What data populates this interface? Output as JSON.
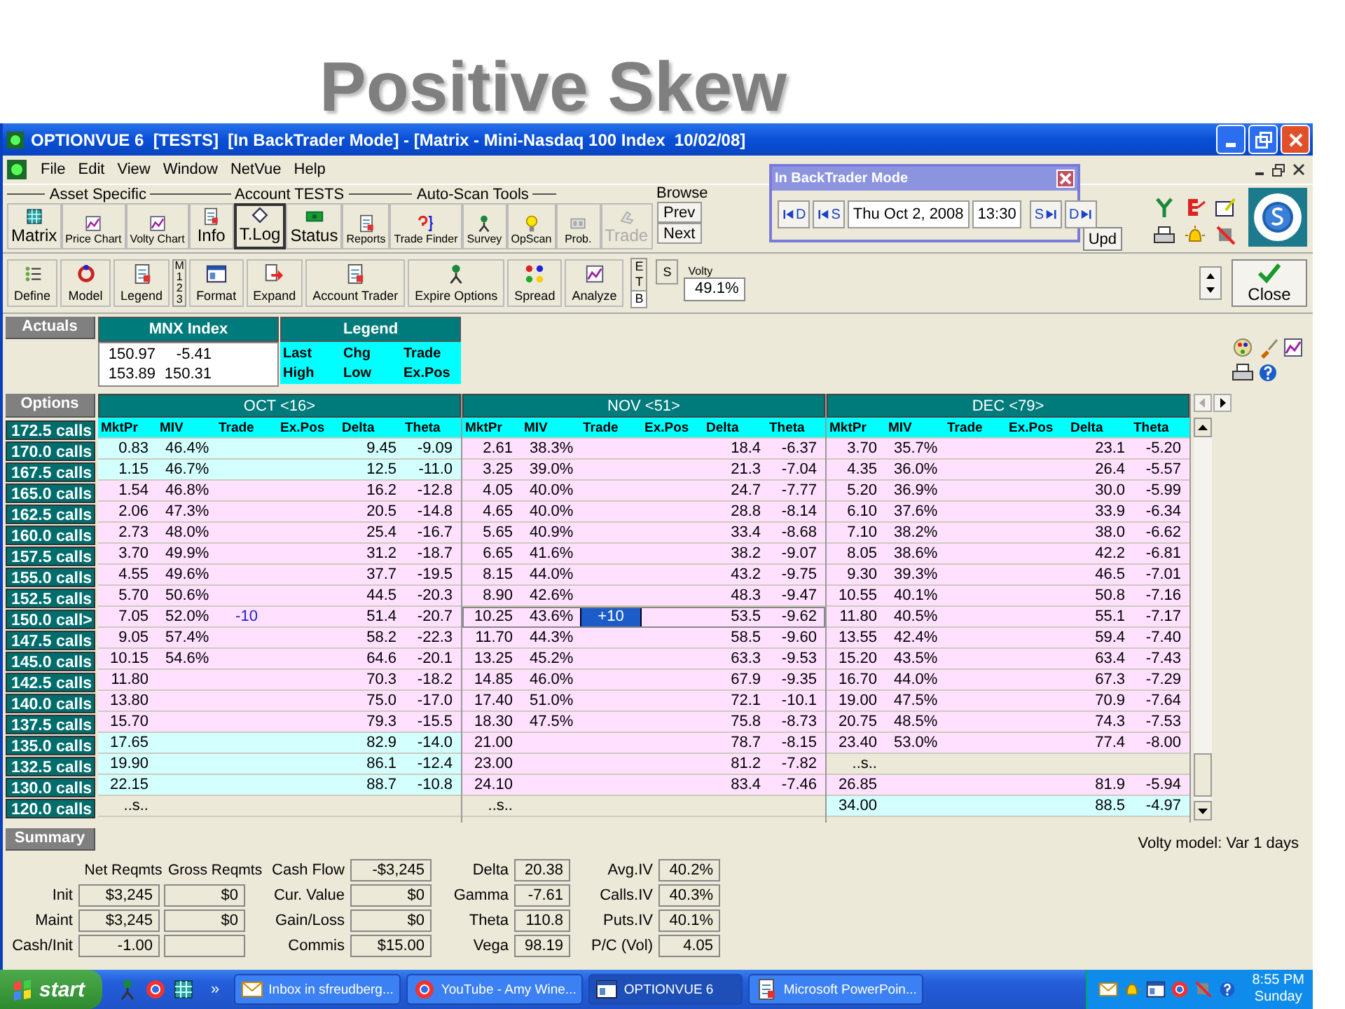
{
  "slide_title": "Positive Skew",
  "window": {
    "title": "OPTIONVUE 6  [TESTS]  [In BackTrader Mode] - [Matrix - Mini-Nasdaq 100 Index  10/02/08]"
  },
  "menu": [
    "File",
    "Edit",
    "View",
    "Window",
    "NetVue",
    "Help"
  ],
  "toolbar": {
    "groups": [
      {
        "label": "Asset Specific",
        "buttons": [
          {
            "label": "Matrix",
            "kind": "large",
            "pressed": false,
            "disabled": false
          },
          {
            "label": "Price Chart",
            "kind": "small",
            "pressed": false,
            "disabled": false
          },
          {
            "label": "Volty Chart",
            "kind": "small",
            "pressed": false,
            "disabled": false
          }
        ]
      },
      {
        "label": "Account TESTS",
        "buttons": [
          {
            "label": "Info",
            "kind": "large",
            "pressed": false,
            "disabled": false
          },
          {
            "label": "T.Log",
            "kind": "large",
            "pressed": true,
            "disabled": false
          },
          {
            "label": "Status",
            "kind": "large",
            "pressed": false,
            "disabled": false
          },
          {
            "label": "Reports",
            "kind": "small",
            "pressed": false,
            "disabled": false
          }
        ]
      },
      {
        "label": "Auto-Scan Tools",
        "buttons": [
          {
            "label": "Trade Finder",
            "kind": "small",
            "pressed": false,
            "disabled": false
          },
          {
            "label": "Survey",
            "kind": "small",
            "pressed": false,
            "disabled": false
          },
          {
            "label": "OpScan",
            "kind": "small",
            "pressed": false,
            "disabled": false
          }
        ]
      }
    ],
    "extra_buttons": [
      {
        "label": "Prob.",
        "kind": "small",
        "pressed": false,
        "disabled": false
      },
      {
        "label": "Trade",
        "kind": "large",
        "pressed": false,
        "disabled": true
      }
    ],
    "browse": {
      "label": "Browse",
      "buttons": [
        "Prev",
        "Next"
      ]
    },
    "update_button": "Upd"
  },
  "toolbar2": {
    "buttons": [
      "Define",
      "Model",
      "Legend",
      "Format",
      "Expand",
      "Account Trader",
      "Expire Options",
      "Spread",
      "Analyze"
    ],
    "matrix_tabs": [
      "M",
      "1",
      "2",
      "3"
    ],
    "view_tabs": [
      {
        "label": "E",
        "selected": false
      },
      {
        "label": "T",
        "selected": false
      },
      {
        "label": "B",
        "selected": true
      }
    ],
    "s_box": "S",
    "volty": {
      "label": "Volty",
      "value": "49.1%"
    },
    "close_button": "Close"
  },
  "backtrader_dialog": {
    "title": "In BackTrader Mode",
    "back_buttons": [
      "D",
      "S"
    ],
    "date": "Thu Oct 2, 2008",
    "time": "13:30",
    "forward_buttons": [
      "S",
      "D"
    ]
  },
  "actuals": {
    "label": "Actuals",
    "index": {
      "title": "MNX Index",
      "rows": [
        [
          "150.97",
          "-5.41"
        ],
        [
          "153.89",
          "150.31"
        ]
      ]
    },
    "legend": {
      "title": "Legend",
      "rows": [
        [
          "Last",
          "Chg",
          "Trade"
        ],
        [
          "High",
          "Low",
          "Ex.Pos"
        ]
      ]
    }
  },
  "options": {
    "label": "Options",
    "strikes": [
      "172.5 calls",
      "170.0 calls",
      "167.5 calls",
      "165.0 calls",
      "162.5 calls",
      "160.0 calls",
      "157.5 calls",
      "155.0 calls",
      "152.5 calls",
      "150.0 call>",
      "147.5 calls",
      "145.0 calls",
      "142.5 calls",
      "140.0 calls",
      "137.5 calls",
      "135.0 calls",
      "132.5 calls",
      "130.0 calls",
      "120.0 calls"
    ],
    "months": [
      {
        "label": "OCT <16>",
        "columns": [
          "MktPr",
          "MIV",
          "Trade",
          "Ex.Pos",
          "Delta",
          "Theta"
        ],
        "rows": [
          {
            "color": "#d4ffff",
            "selected": false,
            "mktpr": "0.83",
            "miv": "46.4%",
            "delta": "9.45",
            "theta": "-9.09"
          },
          {
            "color": "#d4ffff",
            "selected": false,
            "mktpr": "1.15",
            "miv": "46.7%",
            "delta": "12.5",
            "theta": "-11.0"
          },
          {
            "color": "#ffe0ff",
            "selected": false,
            "mktpr": "1.54",
            "miv": "46.8%",
            "delta": "16.2",
            "theta": "-12.8"
          },
          {
            "color": "#ffe0ff",
            "selected": false,
            "mktpr": "2.06",
            "miv": "47.3%",
            "delta": "20.5",
            "theta": "-14.8"
          },
          {
            "color": "#ffe0ff",
            "selected": false,
            "mktpr": "2.73",
            "miv": "48.0%",
            "delta": "25.4",
            "theta": "-16.7"
          },
          {
            "color": "#ffe0ff",
            "selected": false,
            "mktpr": "3.70",
            "miv": "49.9%",
            "delta": "31.2",
            "theta": "-18.7"
          },
          {
            "color": "#ffe0ff",
            "selected": false,
            "mktpr": "4.55",
            "miv": "49.6%",
            "delta": "37.7",
            "theta": "-19.5"
          },
          {
            "color": "#ffe0ff",
            "selected": false,
            "mktpr": "5.70",
            "miv": "50.6%",
            "delta": "44.5",
            "theta": "-20.3"
          },
          {
            "color": "#ffe0ff",
            "selected": false,
            "mktpr": "7.05",
            "miv": "52.0%",
            "trade": "-10",
            "delta": "51.4",
            "theta": "-20.7"
          },
          {
            "color": "#ffe0ff",
            "selected": false,
            "mktpr": "9.05",
            "miv": "57.4%",
            "delta": "58.2",
            "theta": "-22.3"
          },
          {
            "color": "#ffe0ff",
            "selected": false,
            "mktpr": "10.15",
            "miv": "54.6%",
            "delta": "64.6",
            "theta": "-20.1"
          },
          {
            "color": "#ffe0ff",
            "selected": false,
            "mktpr": "11.80",
            "delta": "70.3",
            "theta": "-18.2"
          },
          {
            "color": "#ffe0ff",
            "selected": false,
            "mktpr": "13.80",
            "delta": "75.0",
            "theta": "-17.0"
          },
          {
            "color": "#ffe0ff",
            "selected": false,
            "mktpr": "15.70",
            "delta": "79.3",
            "theta": "-15.5"
          },
          {
            "color": "#d4ffff",
            "selected": false,
            "mktpr": "17.65",
            "delta": "82.9",
            "theta": "-14.0"
          },
          {
            "color": "#d4ffff",
            "selected": false,
            "mktpr": "19.90",
            "delta": "86.1",
            "theta": "-12.4"
          },
          {
            "color": "#d4ffff",
            "selected": false,
            "mktpr": "22.15",
            "delta": "88.7",
            "theta": "-10.8"
          },
          {
            "color": "#ece9d8",
            "selected": false,
            "mktpr": "..s.."
          }
        ]
      },
      {
        "label": "NOV <51>",
        "columns": [
          "MktPr",
          "MIV",
          "Trade",
          "Ex.Pos",
          "Delta",
          "Theta"
        ],
        "rows": [
          {
            "color": "#ffe0ff",
            "selected": false,
            "mktpr": "2.61",
            "miv": "38.3%",
            "delta": "18.4",
            "theta": "-6.37"
          },
          {
            "color": "#ffe0ff",
            "selected": false,
            "mktpr": "3.25",
            "miv": "39.0%",
            "delta": "21.3",
            "theta": "-7.04"
          },
          {
            "color": "#ffe0ff",
            "selected": false,
            "mktpr": "4.05",
            "miv": "40.0%",
            "delta": "24.7",
            "theta": "-7.77"
          },
          {
            "color": "#ffe0ff",
            "selected": false,
            "mktpr": "4.65",
            "miv": "40.0%",
            "delta": "28.8",
            "theta": "-8.14"
          },
          {
            "color": "#ffe0ff",
            "selected": false,
            "mktpr": "5.65",
            "miv": "40.9%",
            "delta": "33.4",
            "theta": "-8.68"
          },
          {
            "color": "#ffe0ff",
            "selected": false,
            "mktpr": "6.65",
            "miv": "41.6%",
            "delta": "38.2",
            "theta": "-9.07"
          },
          {
            "color": "#ffe0ff",
            "selected": false,
            "mktpr": "8.15",
            "miv": "44.0%",
            "delta": "43.2",
            "theta": "-9.75"
          },
          {
            "color": "#ffe0ff",
            "selected": false,
            "mktpr": "8.90",
            "miv": "42.6%",
            "delta": "48.3",
            "theta": "-9.47"
          },
          {
            "color": "#ffe0ff",
            "selected": true,
            "mktpr": "10.25",
            "miv": "43.6%",
            "trade": "+10",
            "delta": "53.5",
            "theta": "-9.62"
          },
          {
            "color": "#ffe0ff",
            "selected": false,
            "mktpr": "11.70",
            "miv": "44.3%",
            "delta": "58.5",
            "theta": "-9.60"
          },
          {
            "color": "#ffe0ff",
            "selected": false,
            "mktpr": "13.25",
            "miv": "45.2%",
            "delta": "63.3",
            "theta": "-9.53"
          },
          {
            "color": "#ffe0ff",
            "selected": false,
            "mktpr": "14.85",
            "miv": "46.0%",
            "delta": "67.9",
            "theta": "-9.35"
          },
          {
            "color": "#ffe0ff",
            "selected": false,
            "mktpr": "17.40",
            "miv": "51.0%",
            "delta": "72.1",
            "theta": "-10.1"
          },
          {
            "color": "#ffe0ff",
            "selected": false,
            "mktpr": "18.30",
            "miv": "47.5%",
            "delta": "75.8",
            "theta": "-8.73"
          },
          {
            "color": "#ffe0ff",
            "selected": false,
            "mktpr": "21.00",
            "delta": "78.7",
            "theta": "-8.15"
          },
          {
            "color": "#ffe0ff",
            "selected": false,
            "mktpr": "23.00",
            "delta": "81.2",
            "theta": "-7.82"
          },
          {
            "color": "#ffe0ff",
            "selected": false,
            "mktpr": "24.10",
            "delta": "83.4",
            "theta": "-7.46"
          },
          {
            "color": "#ece9d8",
            "selected": false,
            "mktpr": "..s.."
          }
        ]
      },
      {
        "label": "DEC <79>",
        "columns": [
          "MktPr",
          "MIV",
          "Trade",
          "Ex.Pos",
          "Delta",
          "Theta"
        ],
        "rows": [
          {
            "color": "#ffe0ff",
            "selected": false,
            "mktpr": "3.70",
            "miv": "35.7%",
            "delta": "23.1",
            "theta": "-5.20"
          },
          {
            "color": "#ffe0ff",
            "selected": false,
            "mktpr": "4.35",
            "miv": "36.0%",
            "delta": "26.4",
            "theta": "-5.57"
          },
          {
            "color": "#ffe0ff",
            "selected": false,
            "mktpr": "5.20",
            "miv": "36.9%",
            "delta": "30.0",
            "theta": "-5.99"
          },
          {
            "color": "#ffe0ff",
            "selected": false,
            "mktpr": "6.10",
            "miv": "37.6%",
            "delta": "33.9",
            "theta": "-6.34"
          },
          {
            "color": "#ffe0ff",
            "selected": false,
            "mktpr": "7.10",
            "miv": "38.2%",
            "delta": "38.0",
            "theta": "-6.62"
          },
          {
            "color": "#ffe0ff",
            "selected": false,
            "mktpr": "8.05",
            "miv": "38.6%",
            "delta": "42.2",
            "theta": "-6.81"
          },
          {
            "color": "#ffe0ff",
            "selected": false,
            "mktpr": "9.30",
            "miv": "39.3%",
            "delta": "46.5",
            "theta": "-7.01"
          },
          {
            "color": "#ffe0ff",
            "selected": false,
            "mktpr": "10.55",
            "miv": "40.1%",
            "delta": "50.8",
            "theta": "-7.16"
          },
          {
            "color": "#ffe0ff",
            "selected": false,
            "mktpr": "11.80",
            "miv": "40.5%",
            "delta": "55.1",
            "theta": "-7.17"
          },
          {
            "color": "#ffe0ff",
            "selected": false,
            "mktpr": "13.55",
            "miv": "42.4%",
            "delta": "59.4",
            "theta": "-7.40"
          },
          {
            "color": "#ffe0ff",
            "selected": false,
            "mktpr": "15.20",
            "miv": "43.5%",
            "delta": "63.4",
            "theta": "-7.43"
          },
          {
            "color": "#ffe0ff",
            "selected": false,
            "mktpr": "16.70",
            "miv": "44.0%",
            "delta": "67.3",
            "theta": "-7.29"
          },
          {
            "color": "#ffe0ff",
            "selected": false,
            "mktpr": "19.00",
            "miv": "47.5%",
            "delta": "70.9",
            "theta": "-7.64"
          },
          {
            "color": "#ffe0ff",
            "selected": false,
            "mktpr": "20.75",
            "miv": "48.5%",
            "delta": "74.3",
            "theta": "-7.53"
          },
          {
            "color": "#ffe0ff",
            "selected": false,
            "mktpr": "23.40",
            "miv": "53.0%",
            "delta": "77.4",
            "theta": "-8.00"
          },
          {
            "color": "#ece9d8",
            "selected": false,
            "mktpr": "..s.."
          },
          {
            "color": "#ffe0ff",
            "selected": false,
            "mktpr": "26.85",
            "delta": "81.9",
            "theta": "-5.94"
          },
          {
            "color": "#d4ffff",
            "selected": false,
            "mktpr": "34.00",
            "delta": "88.5",
            "theta": "-4.97"
          }
        ]
      }
    ]
  },
  "summary": {
    "label": "Summary",
    "volty_model": "Volty model: Var 1 days",
    "requirements": {
      "headers": [
        "Net Reqmts",
        "Gross Reqmts"
      ],
      "rows": [
        {
          "label": "Init",
          "net": "$3,245",
          "gross": "$0"
        },
        {
          "label": "Maint",
          "net": "$3,245",
          "gross": "$0"
        },
        {
          "label": "Cash/Init",
          "net": "-1.00"
        }
      ]
    },
    "columns": [
      [
        {
          "label": "Cash Flow",
          "value": "-$3,245"
        },
        {
          "label": "Cur. Value",
          "value": "$0"
        },
        {
          "label": "Gain/Loss",
          "value": "$0"
        },
        {
          "label": "Commis",
          "value": "$15.00"
        }
      ],
      [
        {
          "label": "Delta",
          "value": "20.38"
        },
        {
          "label": "Gamma",
          "value": "-7.61"
        },
        {
          "label": "Theta",
          "value": "110.8"
        },
        {
          "label": "Vega",
          "value": "98.19"
        }
      ],
      [
        {
          "label": "Avg.IV",
          "value": "40.2%"
        },
        {
          "label": "Calls.IV",
          "value": "40.3%"
        },
        {
          "label": "Puts.IV",
          "value": "40.1%"
        },
        {
          "label": "P/C (Vol)",
          "value": "4.05"
        }
      ]
    ]
  },
  "taskbar": {
    "start": "start",
    "overflow": "»",
    "tasks": [
      {
        "label": "Inbox in sfreudberg...",
        "selected": false
      },
      {
        "label": "YouTube - Amy Wine...",
        "selected": false
      },
      {
        "label": "OPTIONVUE 6",
        "selected": true
      },
      {
        "label": "Microsoft PowerPoin...",
        "selected": false
      }
    ],
    "clock": "8:55 PM",
    "day": "Sunday"
  }
}
